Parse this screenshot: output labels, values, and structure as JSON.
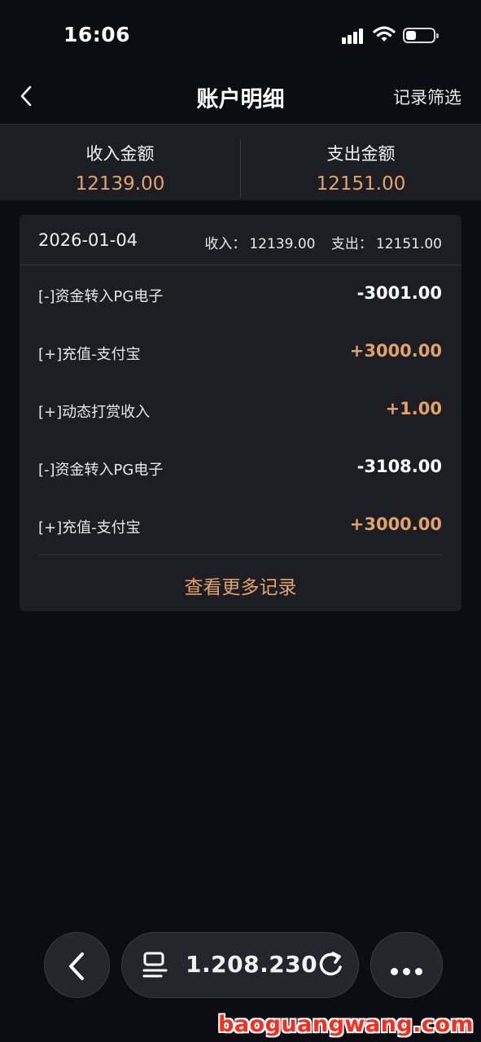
{
  "status_bar": {
    "time": "16:06"
  },
  "header": {
    "title": "账户明细",
    "filter_label": "记录筛选"
  },
  "summary": {
    "income_label": "收入金额",
    "income_value": "12139.00",
    "expense_label": "支出金额",
    "expense_value": "12151.00"
  },
  "card": {
    "date": "2026-01-04",
    "income_label": "收入：",
    "income_total": "12139.00",
    "expense_label": "支出：",
    "expense_total": "12151.00",
    "transactions": [
      {
        "title": "[-]资金转入PG电子",
        "amount": "-3001.00",
        "type": "neg"
      },
      {
        "title": "[+]充值-支付宝",
        "amount": "+3000.00",
        "type": "pos"
      },
      {
        "title": "[+]动态打赏收入",
        "amount": "+1.00",
        "type": "pos"
      },
      {
        "title": "[-]资金转入PG电子",
        "amount": "-3108.00",
        "type": "neg"
      },
      {
        "title": "[+]充值-支付宝",
        "amount": "+3000.00",
        "type": "pos"
      }
    ],
    "more_label": "查看更多记录"
  },
  "browser_bar": {
    "url": "1.208.230"
  },
  "watermark": "baoguangwang.com",
  "colors": {
    "accent": "#e0a36a",
    "background": "#0b0d12",
    "panel": "#1c1e24"
  },
  "icons": [
    "back-chevron-icon",
    "signal-icon",
    "wifi-icon",
    "battery-icon",
    "url-list-icon",
    "reload-icon",
    "more-dots-icon"
  ]
}
